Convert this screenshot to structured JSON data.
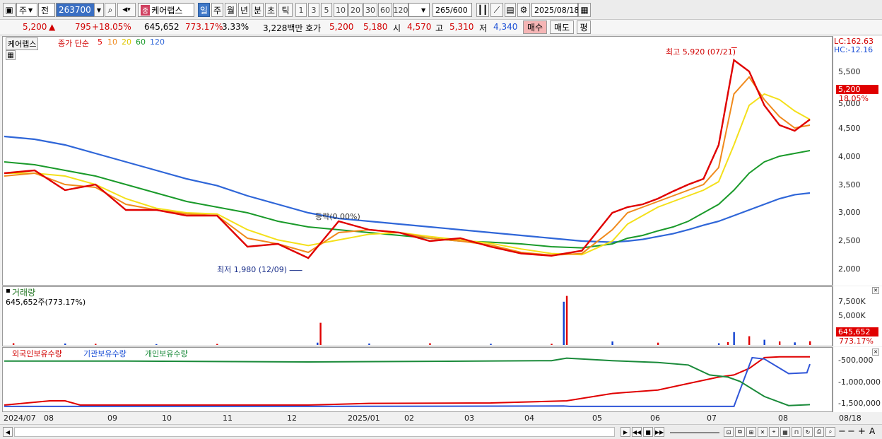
{
  "toolbar": {
    "market": "주",
    "scope": "전",
    "code": "263700",
    "name": "케어랩스",
    "name_badge": "종",
    "periods": [
      "일",
      "주",
      "월",
      "년",
      "분",
      "초",
      "틱"
    ],
    "active_period": "일",
    "intervals": [
      "1",
      "3",
      "5",
      "10",
      "20",
      "30",
      "60",
      "120"
    ],
    "count": "265",
    "count_total": "/600",
    "date": "2025/08/18"
  },
  "quote": {
    "price": "5,200",
    "up_arrow": "▲",
    "change": "795",
    "change_pct": "+18.05%",
    "volume": "645,652",
    "volume_ratio": "773.17%",
    "turnover": "3.33%",
    "amount": "3,228백만",
    "label_ask": "호가",
    "ask": "5,200",
    "bid": "5,180",
    "label_open": "시",
    "open": "4,570",
    "label_high": "고",
    "high": "5,310",
    "label_low": "저",
    "low": "4,340",
    "buy_label": "매수",
    "sell_label": "매도",
    "eval_label": "평"
  },
  "price_panel": {
    "legend_name": "케어랩스",
    "legend_title": "종가 단순",
    "ma_labels": [
      "5",
      "10",
      "20",
      "60",
      "120"
    ],
    "lc_label": "LC:162.63",
    "hc_label": "HC:-12.16",
    "current_price": "5,200",
    "current_pct": "18.05%",
    "high_annotation": "최고 5,920 (07/21)",
    "low_annotation": "최저 1,980 (12/09)",
    "mid_annotation": "등락(0.00%)",
    "y_ticks": [
      "5,500",
      "5,000",
      "4,500",
      "4,000",
      "3,500",
      "3,000",
      "2,500",
      "2,000"
    ]
  },
  "volume_panel": {
    "title": "거래량",
    "value_label": "645,652주(773.17%)",
    "y_ticks": [
      "7,500K",
      "5,000K"
    ],
    "current": "645,652",
    "current_pct": "773.17%"
  },
  "holdings_panel": {
    "legend": [
      "외국인보유수량",
      "기관보유수량",
      "개인보유수량"
    ],
    "y_ticks": [
      "-500,000",
      "-1,000,000",
      "-1,500,000"
    ]
  },
  "x_axis": [
    "2024/07",
    "08",
    "09",
    "10",
    "11",
    "12",
    "2025/01",
    "02",
    "03",
    "04",
    "05",
    "06",
    "07",
    "08",
    "08/18"
  ],
  "colors": {
    "up": "#e00000",
    "down": "#1040d0",
    "ma5": "#e00000",
    "ma10": "#f08a1c",
    "ma20": "#f4e01a",
    "ma60": "#1a9a2a",
    "ma120": "#2f66d8"
  },
  "chart_data": [
    {
      "type": "line",
      "title": "종가 단순",
      "y_ticks": [
        2000,
        2500,
        3000,
        3500,
        4000,
        4500,
        5000,
        5500
      ],
      "x_ticks": [
        "2024/07",
        "08",
        "09",
        "10",
        "11",
        "12",
        "2025/01",
        "02",
        "03",
        "04",
        "05",
        "06",
        "07",
        "08"
      ],
      "series": [
        {
          "name": "5",
          "x": [
            0,
            10,
            20,
            30,
            40,
            50,
            60,
            70,
            80,
            90,
            100,
            110,
            120,
            130,
            140,
            150,
            160,
            170,
            180,
            190,
            200,
            205,
            210,
            215,
            220,
            225,
            230,
            235,
            240,
            245,
            250,
            255,
            260,
            265
          ],
          "values": [
            3700,
            3750,
            3400,
            3500,
            3050,
            3050,
            2950,
            2950,
            2400,
            2450,
            2200,
            2850,
            2700,
            2650,
            2500,
            2550,
            2400,
            2280,
            2240,
            2330,
            3000,
            3100,
            3150,
            3250,
            3380,
            3500,
            3600,
            4200,
            5700,
            5500,
            4900,
            4550,
            4450,
            4650
          ]
        },
        {
          "name": "10",
          "x": [
            0,
            10,
            20,
            30,
            40,
            50,
            60,
            70,
            80,
            90,
            100,
            110,
            120,
            130,
            140,
            150,
            160,
            170,
            180,
            190,
            200,
            205,
            210,
            215,
            220,
            225,
            230,
            235,
            240,
            245,
            250,
            255,
            260,
            265
          ],
          "values": [
            3650,
            3700,
            3500,
            3450,
            3150,
            3050,
            2980,
            2950,
            2550,
            2450,
            2300,
            2650,
            2700,
            2650,
            2550,
            2500,
            2430,
            2300,
            2250,
            2280,
            2700,
            3000,
            3100,
            3200,
            3300,
            3400,
            3500,
            3800,
            5100,
            5400,
            5000,
            4700,
            4500,
            4550
          ]
        },
        {
          "name": "20",
          "x": [
            0,
            10,
            20,
            30,
            40,
            50,
            60,
            70,
            80,
            90,
            100,
            110,
            120,
            130,
            140,
            150,
            160,
            170,
            180,
            190,
            200,
            205,
            210,
            215,
            220,
            225,
            230,
            235,
            240,
            245,
            250,
            255,
            260,
            265
          ],
          "values": [
            3700,
            3700,
            3650,
            3500,
            3250,
            3080,
            3000,
            2980,
            2700,
            2520,
            2420,
            2520,
            2620,
            2650,
            2580,
            2520,
            2460,
            2360,
            2280,
            2260,
            2500,
            2800,
            2950,
            3100,
            3200,
            3300,
            3400,
            3550,
            4200,
            4900,
            5100,
            5000,
            4800,
            4650
          ]
        },
        {
          "name": "60",
          "x": [
            0,
            10,
            20,
            30,
            40,
            50,
            60,
            70,
            80,
            90,
            100,
            110,
            120,
            130,
            140,
            150,
            160,
            170,
            180,
            190,
            200,
            205,
            210,
            215,
            220,
            225,
            230,
            235,
            240,
            245,
            250,
            255,
            260,
            265
          ],
          "values": [
            3900,
            3850,
            3750,
            3650,
            3500,
            3350,
            3200,
            3100,
            3000,
            2850,
            2750,
            2700,
            2650,
            2600,
            2550,
            2500,
            2480,
            2450,
            2400,
            2380,
            2450,
            2550,
            2600,
            2680,
            2750,
            2850,
            3000,
            3150,
            3400,
            3700,
            3900,
            4000,
            4050,
            4100
          ]
        },
        {
          "name": "120",
          "x": [
            0,
            10,
            20,
            30,
            40,
            50,
            60,
            70,
            80,
            90,
            100,
            110,
            120,
            130,
            140,
            150,
            160,
            170,
            180,
            190,
            200,
            205,
            210,
            215,
            220,
            225,
            230,
            235,
            240,
            245,
            250,
            255,
            260,
            265
          ],
          "values": [
            4350,
            4300,
            4200,
            4050,
            3900,
            3750,
            3600,
            3480,
            3300,
            3150,
            3000,
            2900,
            2850,
            2800,
            2750,
            2700,
            2650,
            2600,
            2550,
            2500,
            2480,
            2500,
            2530,
            2580,
            2630,
            2700,
            2780,
            2850,
            2950,
            3050,
            3150,
            3250,
            3320,
            3350
          ]
        }
      ],
      "annotations": [
        {
          "text": "최고 5,920 (07/21)",
          "x": 241,
          "value": 5920
        },
        {
          "text": "최저 1,980 (12/09)",
          "x": 98,
          "value": 1980
        }
      ]
    },
    {
      "type": "bar",
      "title": "거래량",
      "unit": "K",
      "y_ticks": [
        5000,
        7500
      ],
      "x": [
        3,
        20,
        30,
        50,
        70,
        103,
        104,
        120,
        140,
        160,
        180,
        184,
        185,
        200,
        215,
        235,
        238,
        240,
        245,
        250,
        255,
        260,
        265
      ],
      "values": [
        300,
        250,
        200,
        150,
        180,
        400,
        3800,
        250,
        300,
        200,
        200,
        7400,
        8400,
        600,
        400,
        300,
        500,
        2200,
        1500,
        900,
        600,
        450,
        646
      ]
    },
    {
      "type": "line",
      "title": "보유수량",
      "y_ticks": [
        -1500000,
        -1000000,
        -500000
      ],
      "series": [
        {
          "name": "외국인보유수량",
          "x": [
            0,
            15,
            20,
            25,
            30,
            60,
            100,
            120,
            160,
            185,
            200,
            215,
            225,
            235,
            240,
            245,
            250,
            255,
            265
          ],
          "values": [
            -1550000,
            -1450000,
            -1450000,
            -1550000,
            -1550000,
            -1550000,
            -1550000,
            -1510000,
            -1500000,
            -1450000,
            -1280000,
            -1200000,
            -1050000,
            -900000,
            -850000,
            -700000,
            -450000,
            -430000,
            -430000
          ]
        },
        {
          "name": "기관보유수량",
          "x": [
            0,
            40,
            100,
            184,
            186,
            230,
            240,
            242,
            246,
            250,
            258,
            264,
            265
          ],
          "values": [
            -1580000,
            -1580000,
            -1580000,
            -1570000,
            -1580000,
            -1580000,
            -1580000,
            -1200000,
            -450000,
            -480000,
            -820000,
            -800000,
            -600000
          ]
        },
        {
          "name": "개인보유수량",
          "x": [
            0,
            40,
            100,
            180,
            185,
            200,
            215,
            225,
            232,
            238,
            242,
            250,
            258,
            265
          ],
          "values": [
            -530000,
            -530000,
            -550000,
            -520000,
            -460000,
            -520000,
            -560000,
            -620000,
            -850000,
            -900000,
            -1000000,
            -1350000,
            -1560000,
            -1540000
          ]
        }
      ]
    }
  ]
}
